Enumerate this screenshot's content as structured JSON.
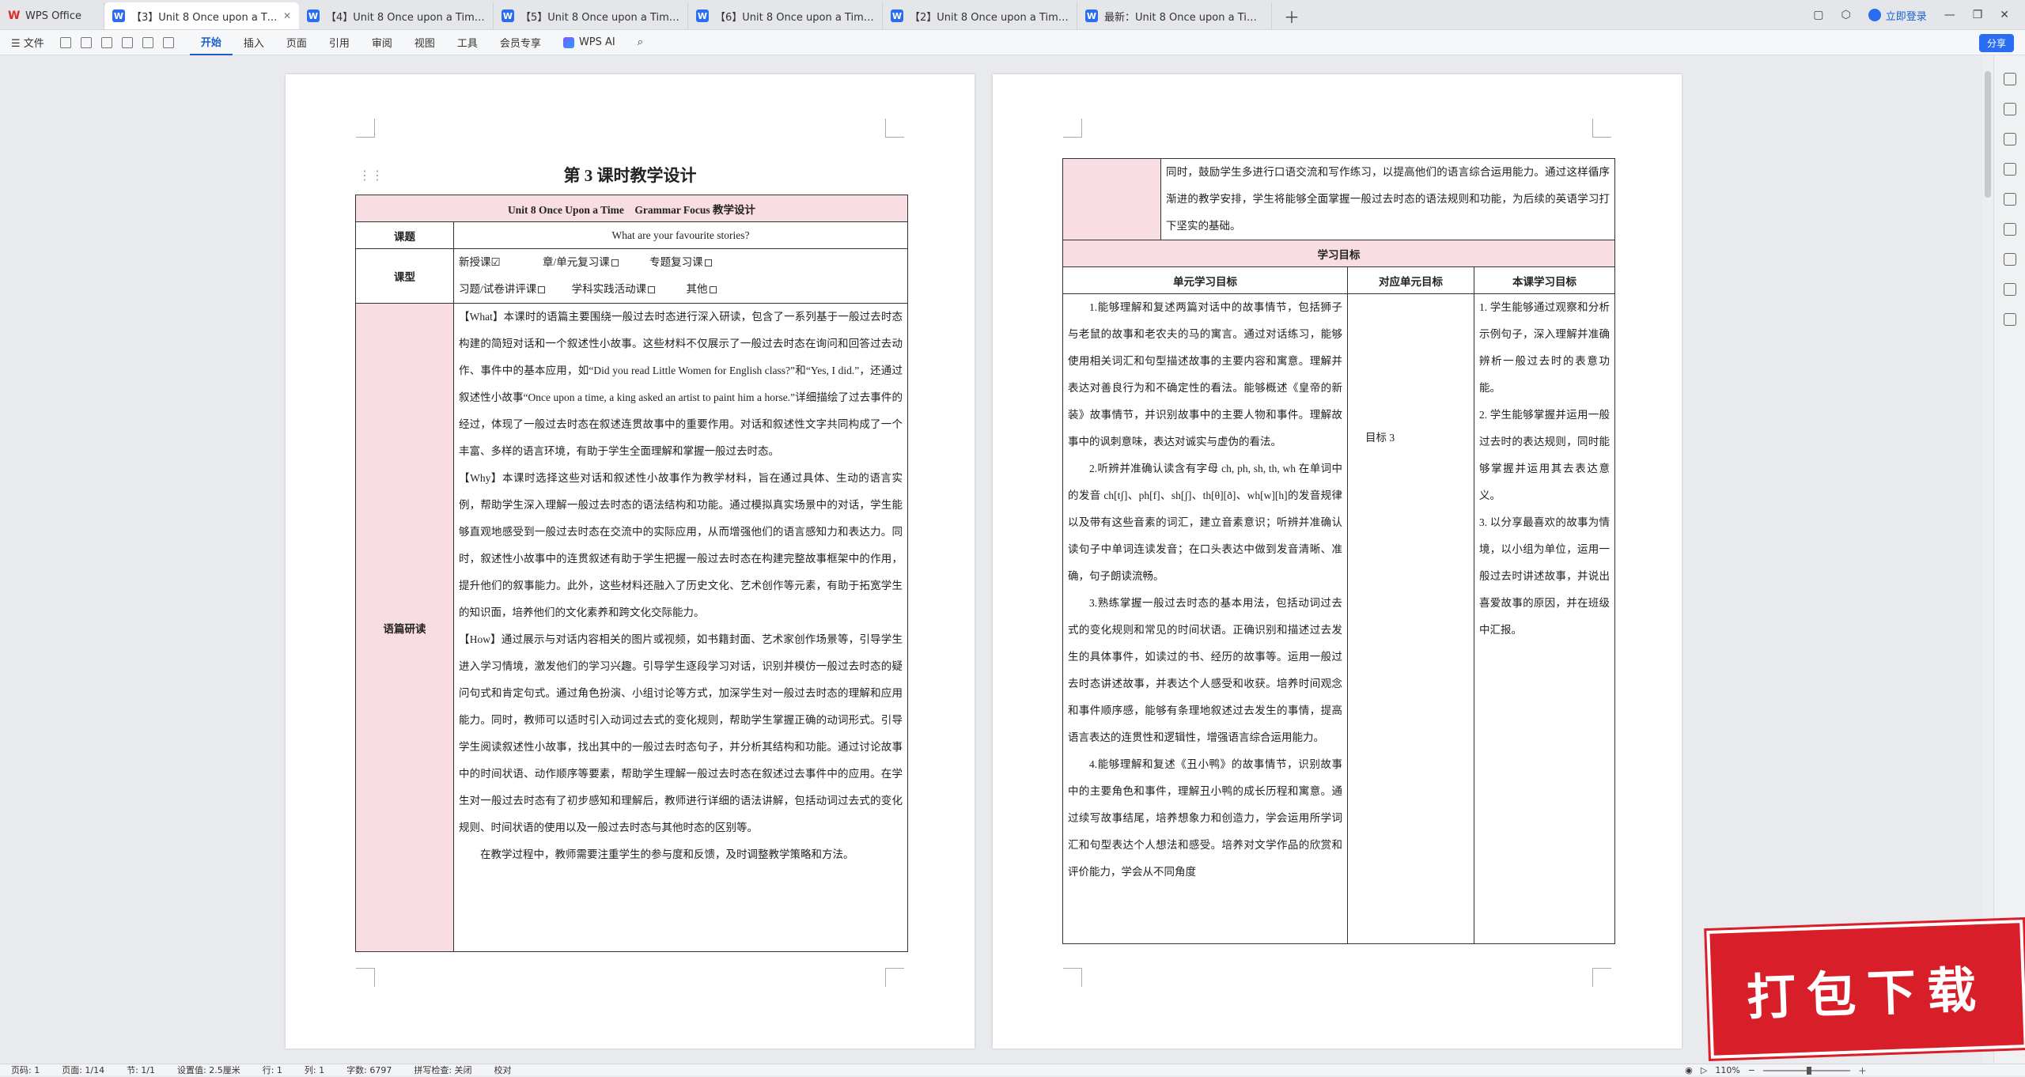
{
  "tabs": [
    {
      "label": "WPS Office",
      "kind": "wps",
      "active": false
    },
    {
      "label": "【3】Unit 8 Once upon a Time",
      "kind": "doc",
      "active": true
    },
    {
      "label": "【4】Unit 8 Once upon a Time 第",
      "kind": "doc",
      "active": false
    },
    {
      "label": "【5】Unit 8 Once upon a Time 第",
      "kind": "doc",
      "active": false
    },
    {
      "label": "【6】Unit 8 Once upon a Time 第",
      "kind": "doc",
      "active": false
    },
    {
      "label": "【2】Unit 8 Once upon a Time 第",
      "kind": "doc",
      "active": false
    },
    {
      "label": "最新：Unit 8 Once upon a Time 大",
      "kind": "doc",
      "active": false
    }
  ],
  "login_label": "立即登录",
  "share_label": "分享",
  "menu": {
    "file": "文件",
    "items": [
      "开始",
      "插入",
      "页面",
      "引用",
      "审阅",
      "视图",
      "工具",
      "会员专享"
    ],
    "active": "开始",
    "wps_ai": "WPS AI"
  },
  "page1": {
    "title": "第 3 课时教学设计",
    "table_title": "Unit 8 Once Upon a Time　Grammar Focus 教学设计",
    "topic_label": "课题",
    "topic_value": "What are your favourite stories?",
    "type_label": "课型",
    "type_options": [
      "新授课☑",
      "章/单元复习课",
      "专题复习课",
      "习题/试卷讲评课",
      "学科实践活动课",
      "其他"
    ],
    "analysis_label": "语篇研读",
    "paragraphs": [
      "【What】本课时的语篇主要围绕一般过去时态进行深入研读，包含了一系列基于一般过去时态构建的简短对话和一个叙述性小故事。这些材料不仅展示了一般过去时态在询问和回答过去动作、事件中的基本应用，如“Did you read Little Women for English class?”和“Yes, I did.”，还通过叙述性小故事“Once upon a time, a king asked an artist to paint him a horse.”详细描绘了过去事件的经过，体现了一般过去时态在叙述连贯故事中的重要作用。对话和叙述性文字共同构成了一个丰富、多样的语言环境，有助于学生全面理解和掌握一般过去时态。",
      "【Why】本课时选择这些对话和叙述性小故事作为教学材料，旨在通过具体、生动的语言实例，帮助学生深入理解一般过去时态的语法结构和功能。通过模拟真实场景中的对话，学生能够直观地感受到一般过去时态在交流中的实际应用，从而增强他们的语言感知力和表达力。同时，叙述性小故事中的连贯叙述有助于学生把握一般过去时态在构建完整故事框架中的作用，提升他们的叙事能力。此外，这些材料还融入了历史文化、艺术创作等元素，有助于拓宽学生的知识面，培养他们的文化素养和跨文化交际能力。",
      "【How】通过展示与对话内容相关的图片或视频，如书籍封面、艺术家创作场景等，引导学生进入学习情境，激发他们的学习兴趣。引导学生逐段学习对话，识别并模仿一般过去时态的疑问句式和肯定句式。通过角色扮演、小组讨论等方式，加深学生对一般过去时态的理解和应用能力。同时，教师可以适时引入动词过去式的变化规则，帮助学生掌握正确的动词形式。引导学生阅读叙述性小故事，找出其中的一般过去时态句子，并分析其结构和功能。通过讨论故事中的时间状语、动作顺序等要素，帮助学生理解一般过去时态在叙述过去事件中的应用。在学生对一般过去时态有了初步感知和理解后，教师进行详细的语法讲解，包括动词过去式的变化规则、时间状语的使用以及一般过去时态与其他时态的区别等。",
      "在教学过程中，教师需要注重学生的参与度和反馈，及时调整教学策略和方法。"
    ]
  },
  "page2": {
    "continued": "同时，鼓励学生多进行口语交流和写作练习，以提高他们的语言综合运用能力。通过这样循序渐进的教学安排，学生将能够全面掌握一般过去时态的语法规则和功能，为后续的英语学习打下坚实的基础。",
    "section_title": "学习目标",
    "col_headers": [
      "单元学习目标",
      "对应单元目标",
      "本课学习目标"
    ],
    "unit_goals": [
      "1.能够理解和复述两篇对话中的故事情节，包括狮子与老鼠的故事和老农夫的马的寓言。通过对话练习，能够使用相关词汇和句型描述故事的主要内容和寓意。理解并表达对善良行为和不确定性的看法。能够概述《皇帝的新装》故事情节，并识别故事中的主要人物和事件。理解故事中的讽刺意味，表达对诚实与虚伪的看法。",
      "2.听辨并准确认读含有字母 ch, ph, sh, th, wh 在单词中的发音 ch[tʃ]、ph[f]、sh[ʃ]、th[θ][ð]、wh[w][h]的发音规律以及带有这些音素的词汇，建立音素意识；听辨并准确认读句子中单词连读发音；在口头表达中做到发音清晰、准确，句子朗读流畅。",
      "3.熟练掌握一般过去时态的基本用法，包括动词过去式的变化规则和常见的时间状语。正确识别和描述过去发生的具体事件，如读过的书、经历的故事等。运用一般过去时态讲述故事，并表达个人感受和收获。培养时间观念和事件顺序感，能够有条理地叙述过去发生的事情，提高语言表达的连贯性和逻辑性，增强语言综合运用能力。",
      "4.能够理解和复述《丑小鸭》的故事情节，识别故事中的主要角色和事件，理解丑小鸭的成长历程和寓意。通过续写故事结尾，培养想象力和创造力，学会运用所学词汇和句型表达个人想法和感受。培养对文学作品的欣赏和评价能力，学会从不同角度"
    ],
    "corresponding": "目标 3",
    "lesson_goals": [
      "1. 学生能够通过观察和分析示例句子，深入理解并准确辨析一般过去时的表意功能。",
      "2. 学生能够掌握并运用一般过去时的表达规则，同时能够掌握并运用其去表达意义。",
      "3. 以分享最喜欢的故事为情境，以小组为单位，运用一般过去时讲述故事，并说出喜爱故事的原因，并在班级中汇报。"
    ],
    "lesson_goal3_prefix": "3."
  },
  "watermark": "打包下载",
  "status": {
    "page": "页码: 1",
    "pages": "页面: 1/14",
    "section": "节: 1/1",
    "setting": "设置值: 2.5厘米",
    "row": "行: 1",
    "col": "列: 1",
    "words": "字数: 6797",
    "spell": "拼写检查: 关闭",
    "proof": "校对",
    "zoom": "110%"
  }
}
